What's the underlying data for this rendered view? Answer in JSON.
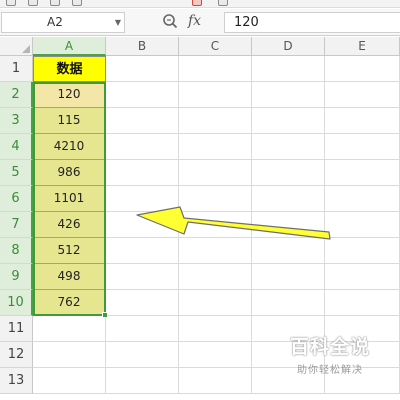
{
  "formula_bar": {
    "name_box": "A2",
    "formula": "120",
    "fx_label": "fx"
  },
  "sheet": {
    "columns": [
      "A",
      "B",
      "C",
      "D",
      "E"
    ],
    "rows": [
      "1",
      "2",
      "3",
      "4",
      "5",
      "6",
      "7",
      "8",
      "9",
      "10",
      "11",
      "12",
      "13"
    ],
    "header": "数据",
    "values": [
      "120",
      "115",
      "4210",
      "986",
      "1101",
      "426",
      "512",
      "498",
      "762"
    ],
    "active_cell": "A2",
    "selection": "A2:A10"
  },
  "watermark": {
    "main": "百科全说",
    "sub": "助你轻松解决"
  },
  "colors": {
    "header_fill": "#ffff00",
    "data_fill": "#e6e690",
    "selection_border": "#3f9a3a",
    "arrow": "#ffff33"
  }
}
